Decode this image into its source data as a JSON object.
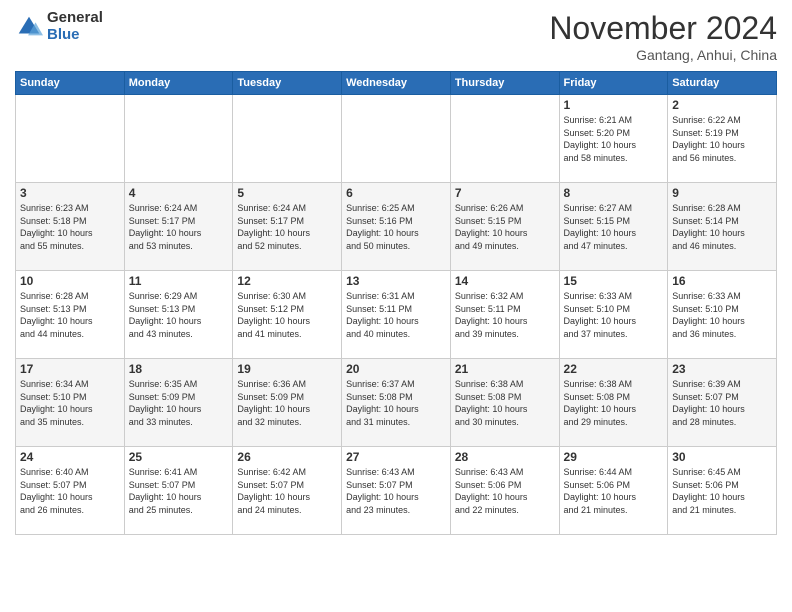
{
  "header": {
    "logo": {
      "general": "General",
      "blue": "Blue"
    },
    "title": "November 2024",
    "location": "Gantang, Anhui, China"
  },
  "weekdays": [
    "Sunday",
    "Monday",
    "Tuesday",
    "Wednesday",
    "Thursday",
    "Friday",
    "Saturday"
  ],
  "weeks": [
    [
      {
        "day": "",
        "info": ""
      },
      {
        "day": "",
        "info": ""
      },
      {
        "day": "",
        "info": ""
      },
      {
        "day": "",
        "info": ""
      },
      {
        "day": "",
        "info": ""
      },
      {
        "day": "1",
        "info": "Sunrise: 6:21 AM\nSunset: 5:20 PM\nDaylight: 10 hours\nand 58 minutes."
      },
      {
        "day": "2",
        "info": "Sunrise: 6:22 AM\nSunset: 5:19 PM\nDaylight: 10 hours\nand 56 minutes."
      }
    ],
    [
      {
        "day": "3",
        "info": "Sunrise: 6:23 AM\nSunset: 5:18 PM\nDaylight: 10 hours\nand 55 minutes."
      },
      {
        "day": "4",
        "info": "Sunrise: 6:24 AM\nSunset: 5:17 PM\nDaylight: 10 hours\nand 53 minutes."
      },
      {
        "day": "5",
        "info": "Sunrise: 6:24 AM\nSunset: 5:17 PM\nDaylight: 10 hours\nand 52 minutes."
      },
      {
        "day": "6",
        "info": "Sunrise: 6:25 AM\nSunset: 5:16 PM\nDaylight: 10 hours\nand 50 minutes."
      },
      {
        "day": "7",
        "info": "Sunrise: 6:26 AM\nSunset: 5:15 PM\nDaylight: 10 hours\nand 49 minutes."
      },
      {
        "day": "8",
        "info": "Sunrise: 6:27 AM\nSunset: 5:15 PM\nDaylight: 10 hours\nand 47 minutes."
      },
      {
        "day": "9",
        "info": "Sunrise: 6:28 AM\nSunset: 5:14 PM\nDaylight: 10 hours\nand 46 minutes."
      }
    ],
    [
      {
        "day": "10",
        "info": "Sunrise: 6:28 AM\nSunset: 5:13 PM\nDaylight: 10 hours\nand 44 minutes."
      },
      {
        "day": "11",
        "info": "Sunrise: 6:29 AM\nSunset: 5:13 PM\nDaylight: 10 hours\nand 43 minutes."
      },
      {
        "day": "12",
        "info": "Sunrise: 6:30 AM\nSunset: 5:12 PM\nDaylight: 10 hours\nand 41 minutes."
      },
      {
        "day": "13",
        "info": "Sunrise: 6:31 AM\nSunset: 5:11 PM\nDaylight: 10 hours\nand 40 minutes."
      },
      {
        "day": "14",
        "info": "Sunrise: 6:32 AM\nSunset: 5:11 PM\nDaylight: 10 hours\nand 39 minutes."
      },
      {
        "day": "15",
        "info": "Sunrise: 6:33 AM\nSunset: 5:10 PM\nDaylight: 10 hours\nand 37 minutes."
      },
      {
        "day": "16",
        "info": "Sunrise: 6:33 AM\nSunset: 5:10 PM\nDaylight: 10 hours\nand 36 minutes."
      }
    ],
    [
      {
        "day": "17",
        "info": "Sunrise: 6:34 AM\nSunset: 5:10 PM\nDaylight: 10 hours\nand 35 minutes."
      },
      {
        "day": "18",
        "info": "Sunrise: 6:35 AM\nSunset: 5:09 PM\nDaylight: 10 hours\nand 33 minutes."
      },
      {
        "day": "19",
        "info": "Sunrise: 6:36 AM\nSunset: 5:09 PM\nDaylight: 10 hours\nand 32 minutes."
      },
      {
        "day": "20",
        "info": "Sunrise: 6:37 AM\nSunset: 5:08 PM\nDaylight: 10 hours\nand 31 minutes."
      },
      {
        "day": "21",
        "info": "Sunrise: 6:38 AM\nSunset: 5:08 PM\nDaylight: 10 hours\nand 30 minutes."
      },
      {
        "day": "22",
        "info": "Sunrise: 6:38 AM\nSunset: 5:08 PM\nDaylight: 10 hours\nand 29 minutes."
      },
      {
        "day": "23",
        "info": "Sunrise: 6:39 AM\nSunset: 5:07 PM\nDaylight: 10 hours\nand 28 minutes."
      }
    ],
    [
      {
        "day": "24",
        "info": "Sunrise: 6:40 AM\nSunset: 5:07 PM\nDaylight: 10 hours\nand 26 minutes."
      },
      {
        "day": "25",
        "info": "Sunrise: 6:41 AM\nSunset: 5:07 PM\nDaylight: 10 hours\nand 25 minutes."
      },
      {
        "day": "26",
        "info": "Sunrise: 6:42 AM\nSunset: 5:07 PM\nDaylight: 10 hours\nand 24 minutes."
      },
      {
        "day": "27",
        "info": "Sunrise: 6:43 AM\nSunset: 5:07 PM\nDaylight: 10 hours\nand 23 minutes."
      },
      {
        "day": "28",
        "info": "Sunrise: 6:43 AM\nSunset: 5:06 PM\nDaylight: 10 hours\nand 22 minutes."
      },
      {
        "day": "29",
        "info": "Sunrise: 6:44 AM\nSunset: 5:06 PM\nDaylight: 10 hours\nand 21 minutes."
      },
      {
        "day": "30",
        "info": "Sunrise: 6:45 AM\nSunset: 5:06 PM\nDaylight: 10 hours\nand 21 minutes."
      }
    ]
  ]
}
